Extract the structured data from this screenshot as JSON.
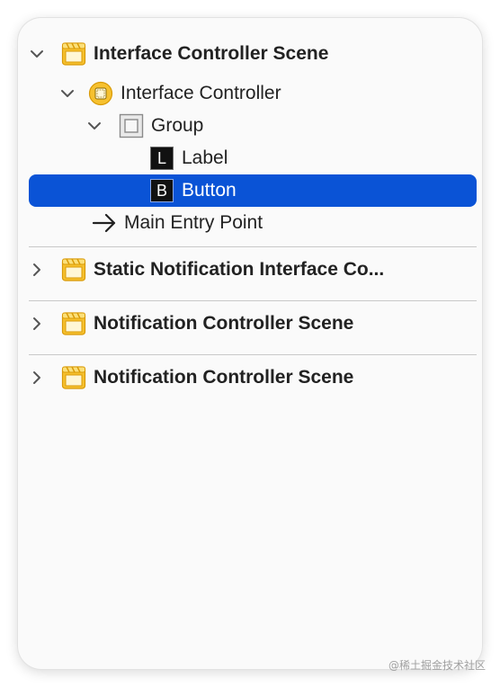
{
  "tree": {
    "scene_interface": {
      "label": "Interface Controller Scene",
      "expanded": true
    },
    "interface_controller": {
      "label": "Interface Controller"
    },
    "group": {
      "label": "Group"
    },
    "label_item": {
      "label": "Label",
      "badge": "L"
    },
    "button_item": {
      "label": "Button",
      "badge": "B",
      "selected": true
    },
    "main_entry": {
      "label": "Main Entry Point"
    },
    "scene_static": {
      "label": "Static Notification Interface Co..."
    },
    "scene_notification_1": {
      "label": "Notification Controller Scene"
    },
    "scene_notification_2": {
      "label": "Notification Controller Scene"
    }
  },
  "watermark": "@稀土掘金技术社区",
  "colors": {
    "selection": "#0a53d6",
    "scene_icon": "#f6c12f",
    "text": "#222222"
  },
  "icons": {
    "scene": "storyboard-scene-icon",
    "controller": "interface-controller-icon",
    "group": "group-icon",
    "entry": "arrow-right-icon",
    "disclosure_open": "chevron-down-icon",
    "disclosure_closed": "chevron-right-icon"
  }
}
